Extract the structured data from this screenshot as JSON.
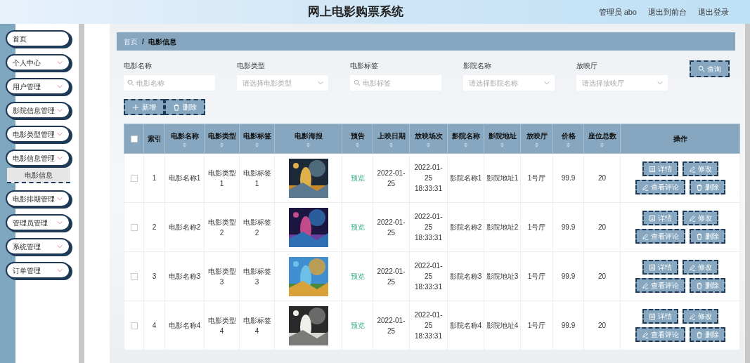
{
  "header": {
    "title": "网上电影购票系统",
    "user": "管理员 abo",
    "links": [
      "退出到前台",
      "退出登录"
    ]
  },
  "sidebar": {
    "items": [
      {
        "label": "首页",
        "kind": "link"
      },
      {
        "label": "个人中心",
        "kind": "menu"
      },
      {
        "label": "用户管理",
        "kind": "menu"
      },
      {
        "label": "影院信息管理",
        "kind": "menu"
      },
      {
        "label": "电影类型管理",
        "kind": "menu"
      },
      {
        "label": "电影信息管理",
        "kind": "menu",
        "expanded": true,
        "children": [
          {
            "label": "电影信息",
            "selected": true
          }
        ]
      },
      {
        "label": "电影排期管理",
        "kind": "menu"
      },
      {
        "label": "管理员管理",
        "kind": "menu"
      },
      {
        "label": "系统管理",
        "kind": "menu"
      },
      {
        "label": "订单管理",
        "kind": "menu"
      }
    ]
  },
  "breadcrumb": [
    "首页",
    "/",
    "电影信息"
  ],
  "filters": [
    {
      "label": "电影名称",
      "kind": "input",
      "placeholder": "电影名称"
    },
    {
      "label": "电影类型",
      "kind": "select",
      "placeholder": "请选择电影类型"
    },
    {
      "label": "电影标签",
      "kind": "input",
      "placeholder": "电影标签"
    },
    {
      "label": "影院名称",
      "kind": "select",
      "placeholder": "请选择影院名称"
    },
    {
      "label": "放映厅",
      "kind": "select",
      "placeholder": "请选择放映厅"
    }
  ],
  "search_button": "查询",
  "actions": [
    "新增",
    "删除"
  ],
  "table": {
    "select_all_checked": false,
    "columns": [
      {
        "label": "索引",
        "sortable": false
      },
      {
        "label": "电影名称",
        "sortable": true
      },
      {
        "label": "电影类型",
        "sortable": true
      },
      {
        "label": "电影标签",
        "sortable": true
      },
      {
        "label": "电影海报",
        "sortable": true
      },
      {
        "label": "预告",
        "sortable": true
      },
      {
        "label": "上映日期",
        "sortable": true
      },
      {
        "label": "放映场次",
        "sortable": true
      },
      {
        "label": "影院名称",
        "sortable": true
      },
      {
        "label": "影院地址",
        "sortable": true
      },
      {
        "label": "放映厅",
        "sortable": true
      },
      {
        "label": "价格",
        "sortable": true
      },
      {
        "label": "座位总数",
        "sortable": true
      },
      {
        "label": "操作",
        "sortable": false
      }
    ],
    "rows": [
      {
        "checked": false,
        "cells": [
          "1",
          "电影名称1",
          "电影类型1",
          "电影标签1",
          "",
          "预览",
          "2022-01-25",
          "2022-01-25 18:33:31",
          "影院名称1",
          "影院地址1",
          "1号厅",
          "99.9",
          "20"
        ],
        "actions": [
          "详情",
          "修改",
          "查看评论",
          "删除"
        ]
      },
      {
        "checked": false,
        "cells": [
          "2",
          "电影名称2",
          "电影类型2",
          "电影标签2",
          "",
          "预览",
          "2022-01-25",
          "2022-01-25 18:33:31",
          "影院名称2",
          "影院地址2",
          "1号厅",
          "99.9",
          "20"
        ],
        "actions": [
          "详情",
          "修改",
          "查看评论",
          "删除"
        ]
      },
      {
        "checked": false,
        "cells": [
          "3",
          "电影名称3",
          "电影类型3",
          "电影标签3",
          "",
          "预览",
          "2022-01-25",
          "2022-01-25 18:33:31",
          "影院名称3",
          "影院地址3",
          "1号厅",
          "99.9",
          "20"
        ],
        "actions": [
          "详情",
          "修改",
          "查看评论",
          "删除"
        ]
      },
      {
        "checked": false,
        "cells": [
          "4",
          "电影名称4",
          "电影类型4",
          "电影标签4",
          "",
          "预览",
          "2022-01-25",
          "2022-01-25 18:33:31",
          "影院名称4",
          "影院地址4",
          "1号厅",
          "99.9",
          "20"
        ],
        "actions": [
          "详情",
          "修改",
          "查看评论",
          "删除"
        ]
      }
    ]
  }
}
